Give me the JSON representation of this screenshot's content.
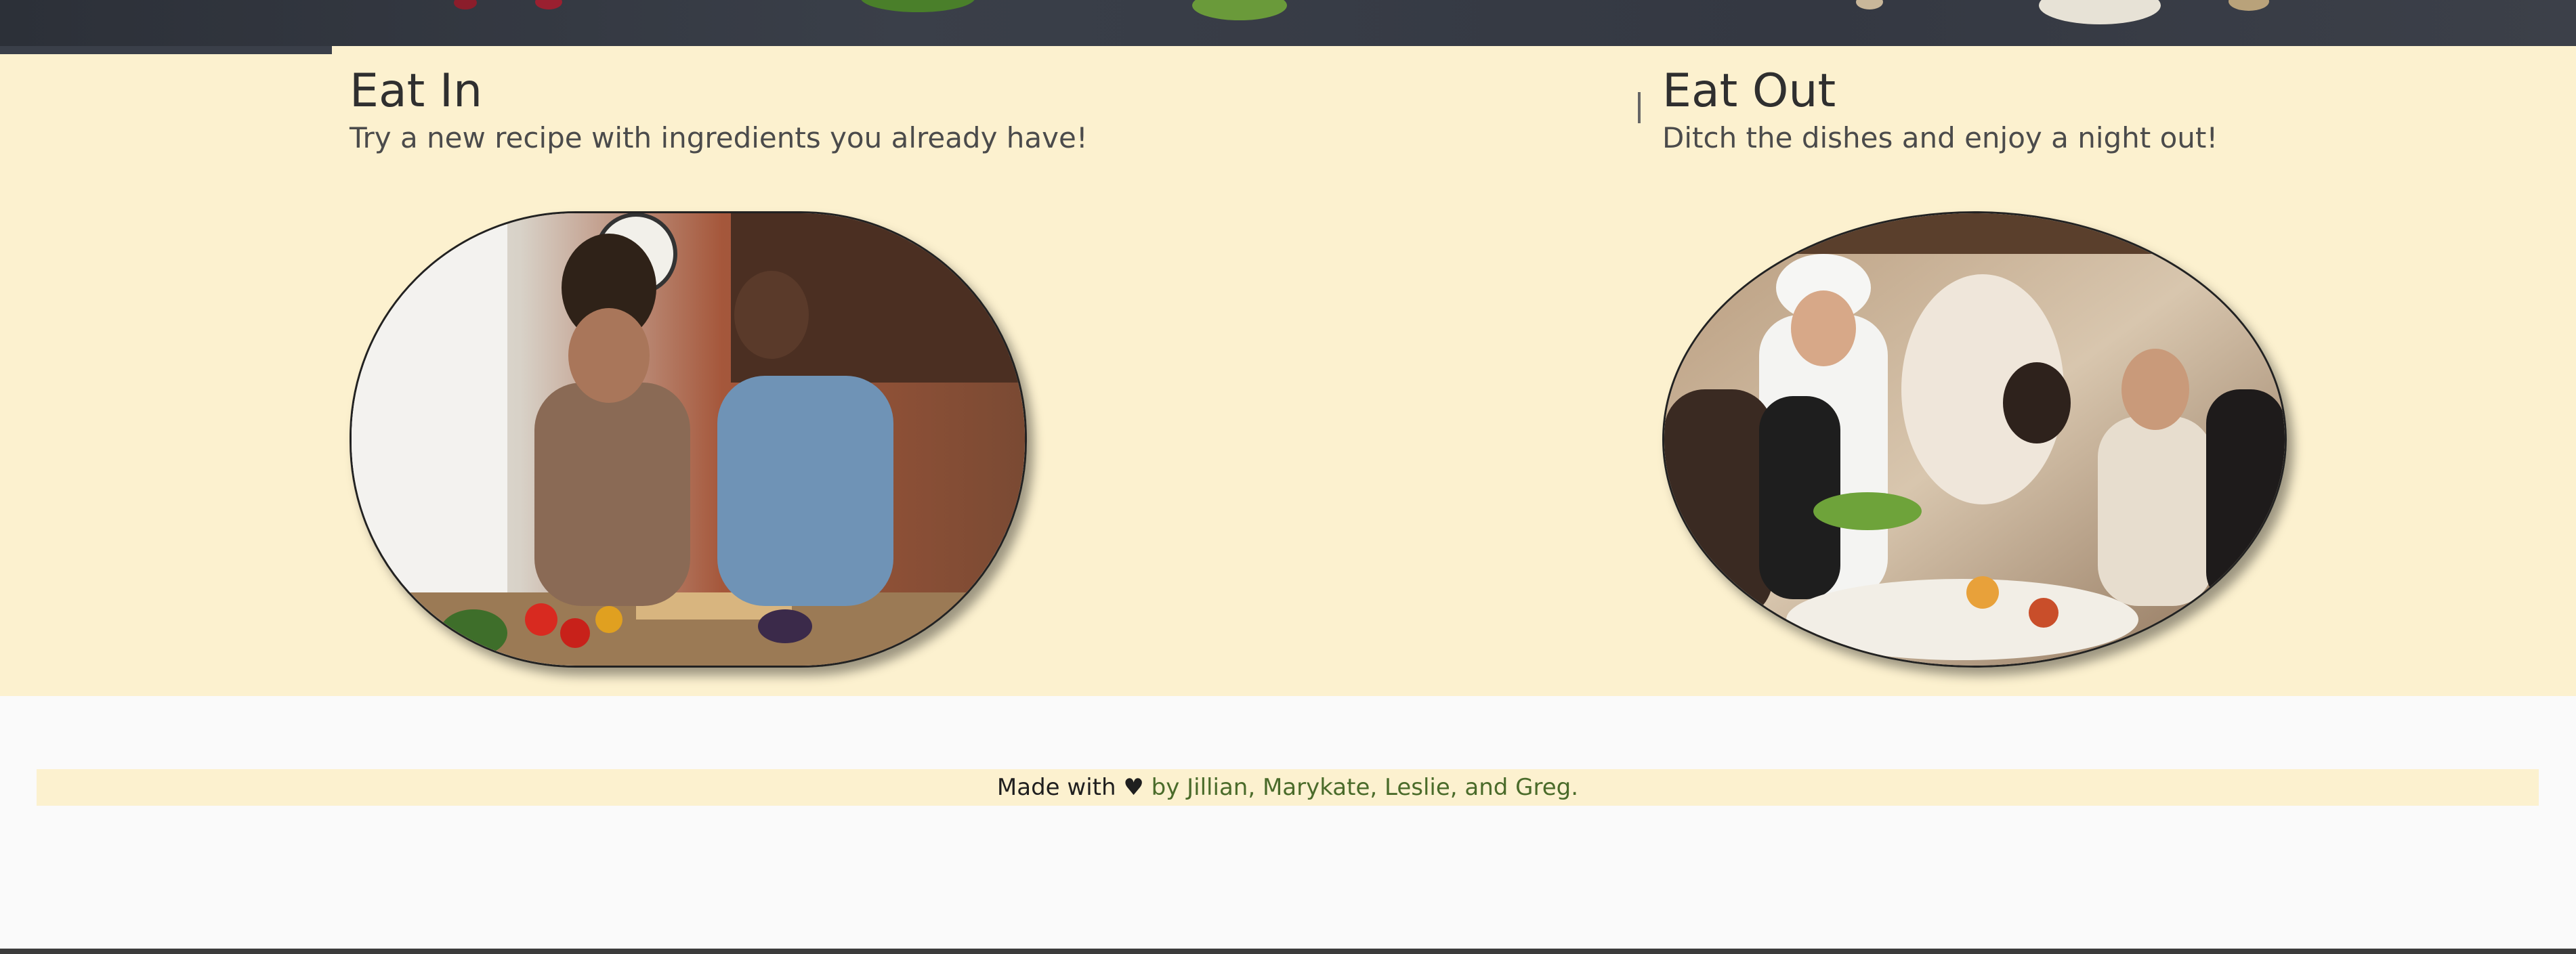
{
  "eat_in": {
    "title": "Eat In",
    "subtitle": "Try a new recipe with ingredients you already have!",
    "image_alt": "two people cooking in a kitchen"
  },
  "eat_out": {
    "title": "Eat Out",
    "subtitle": "Ditch the dishes and enjoy a night out!",
    "image_alt": "chef serving a dish to diners at a restaurant table"
  },
  "footer": {
    "made_with": "Made with ♥",
    "credits": "by Jillian, Marykate, Leslie, and Greg."
  },
  "colors": {
    "panel": "#fcf1cf",
    "page": "#fafafa",
    "hero": "#343842",
    "credits_text": "#4a6b2a"
  }
}
